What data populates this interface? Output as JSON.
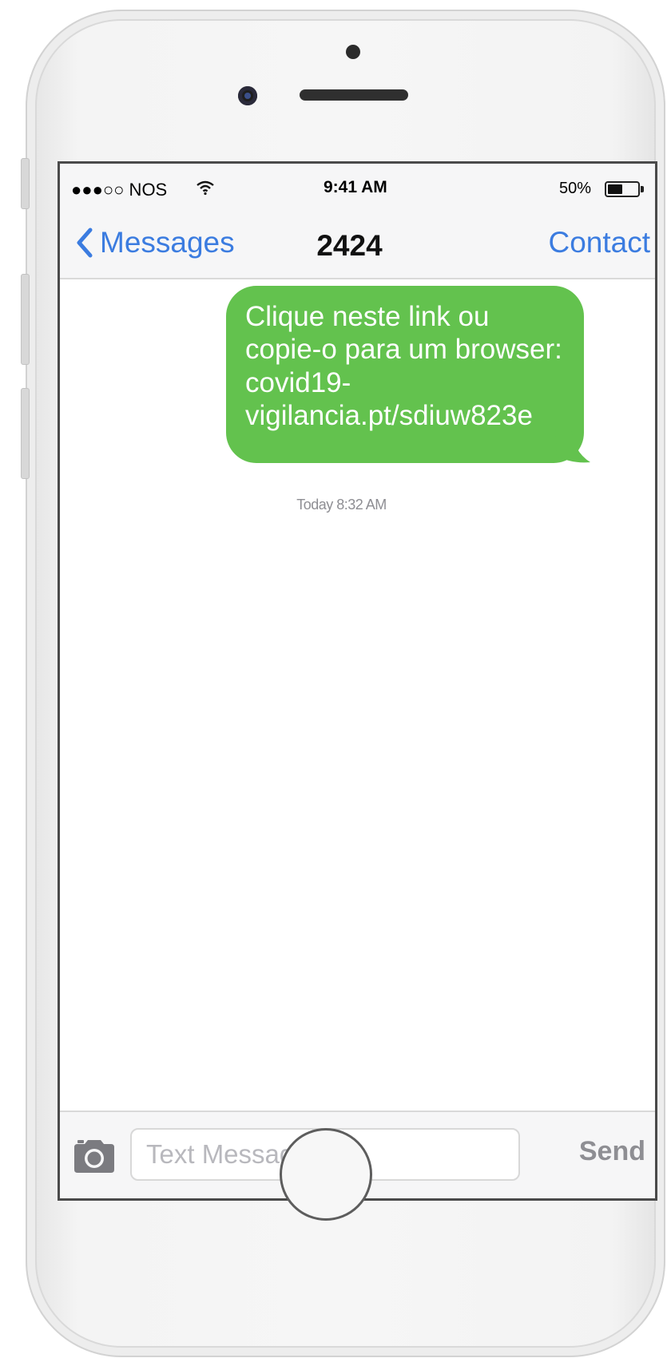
{
  "status_bar": {
    "carrier": "●●●○○ NOS",
    "time": "9:41 AM",
    "battery_percent": "50%",
    "battery_level": 0.5,
    "signal_icon": "wifi-icon"
  },
  "nav": {
    "back_label": "Messages",
    "title": "2424",
    "contact_label": "Contact"
  },
  "conversation": {
    "messages": [
      {
        "text": "Clique neste link ou copie-o para um browser: covid19-vigilancia.pt/sdiuw823e",
        "direction": "outgoing"
      }
    ],
    "timestamp": "Today 8:32 AM"
  },
  "compose": {
    "placeholder": "Text Message",
    "send_label": "Send",
    "camera_icon": "camera-icon"
  },
  "colors": {
    "bubble": "#63c24e",
    "accent": "#3b7ce0"
  }
}
